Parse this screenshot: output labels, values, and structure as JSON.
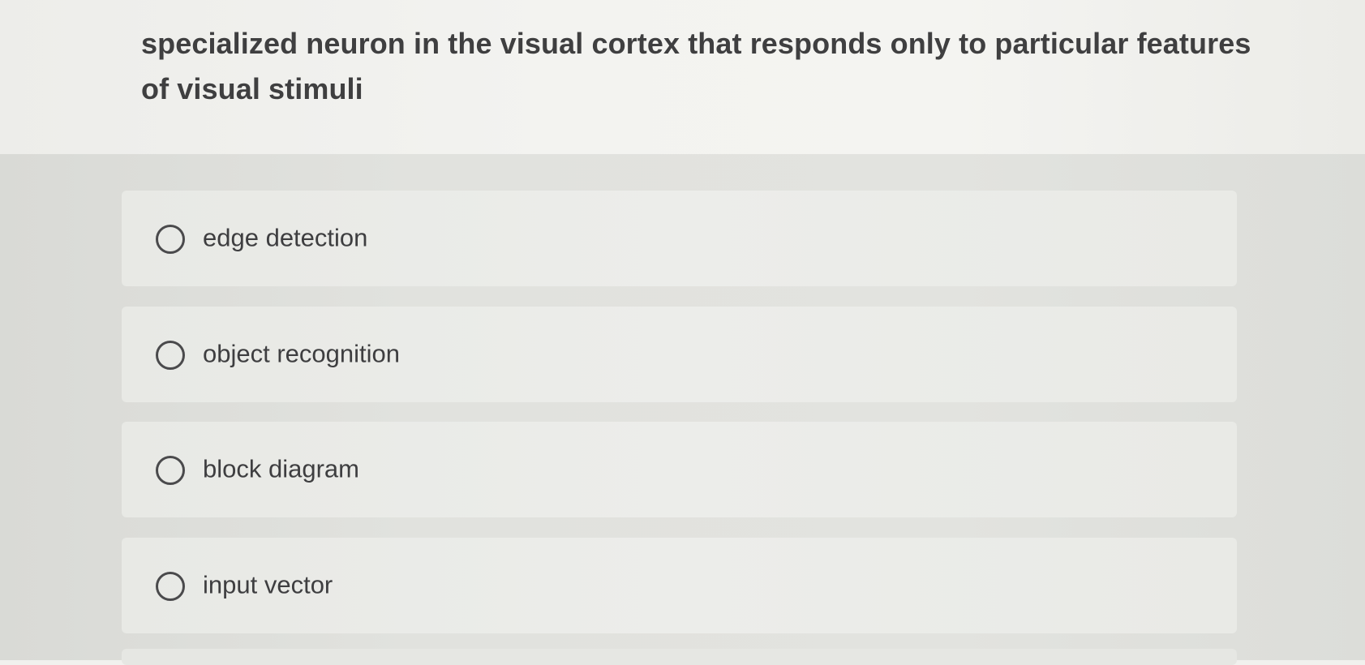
{
  "question": {
    "text": "specialized neuron in the visual cortex that responds only to particular features of visual stimuli"
  },
  "options": [
    {
      "label": "edge detection",
      "selected": false
    },
    {
      "label": "object recognition",
      "selected": false
    },
    {
      "label": "block diagram",
      "selected": false
    },
    {
      "label": "input vector",
      "selected": false
    }
  ],
  "icons": {
    "radio": "radio-button-unselected-icon"
  },
  "colors": {
    "text": "#3e3e40",
    "background": "#e2e3df"
  }
}
